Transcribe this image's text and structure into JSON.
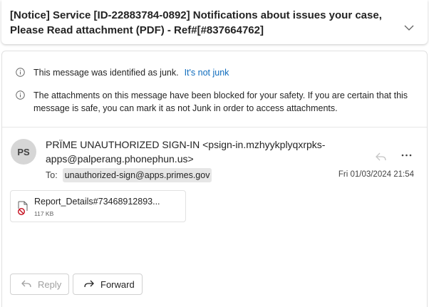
{
  "subject": {
    "title": "[Notice] Service [ID-22883784-0892] Notifications about issues your case, Please Read attachment (PDF) - Ref#[#837664762]",
    "chevron_icon": "chevron-down-icon"
  },
  "notices": {
    "junk_text": "This message was identified as junk.",
    "not_junk_link": "It's not junk",
    "blocked_text": "The attachments on this message have been blocked for your safety. If you are certain that this message is safe, you can mark it as not Junk in order to access attachments."
  },
  "message": {
    "avatar_initials": "PS",
    "sender": "PRÏME UNAUTHORIZED SIGN-IN <psign-in.mzhyykplyqxrpks-apps@palperang.phonephun.us>",
    "to_label": "To:",
    "to_address": "unauthorized-sign@apps.primes.gov",
    "date": "Fri 01/03/2024 21:54"
  },
  "attachment": {
    "name": "Report_Details#73468912893...",
    "size": "117 KB"
  },
  "actions": {
    "reply_label": "Reply",
    "forward_label": "Forward"
  },
  "colors": {
    "link": "#0f6cbd",
    "blocked_icon": "#c50f1f",
    "avatar_bg": "#d6d6d6"
  }
}
